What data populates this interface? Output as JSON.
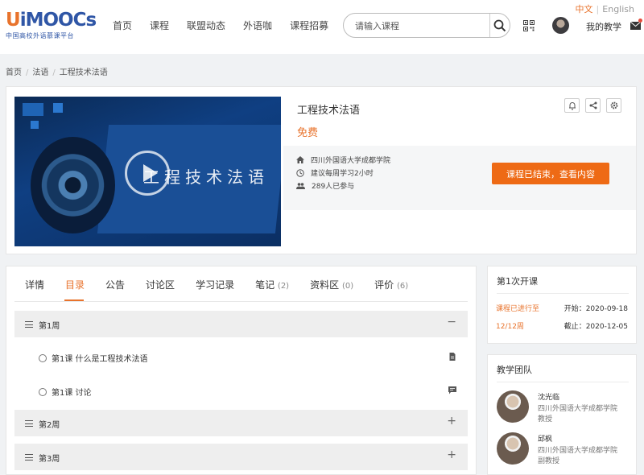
{
  "lang": {
    "zh": "中文",
    "sep": "|",
    "en": "English"
  },
  "logo": {
    "mark_u": "U",
    "mark_rest": "iMOOCs",
    "tagline": "中国高校外语慕课平台"
  },
  "nav": [
    "首页",
    "课程",
    "联盟动态",
    "外语咖",
    "课程招募"
  ],
  "search": {
    "placeholder": "请输入课程"
  },
  "user": {
    "my_teaching": "我的教学"
  },
  "breadcrumb": [
    "首页",
    "法语",
    "工程技术法语"
  ],
  "course": {
    "cover_title": "工程技术法语",
    "title": "工程技术法语",
    "price": "免费",
    "school": "四川外国语大学成都学院",
    "study_time": "建议每周学习2小时",
    "participants": "289人已参与",
    "status_button": "课程已结束，查看内容"
  },
  "tabs": [
    {
      "label": "详情",
      "count": ""
    },
    {
      "label": "目录",
      "count": ""
    },
    {
      "label": "公告",
      "count": ""
    },
    {
      "label": "讨论区",
      "count": ""
    },
    {
      "label": "学习记录",
      "count": ""
    },
    {
      "label": "笔记",
      "count": "(2)"
    },
    {
      "label": "资料区",
      "count": "(0)"
    },
    {
      "label": "评价",
      "count": "(6)"
    }
  ],
  "weeks": [
    {
      "label": "第1周",
      "toggle": "−"
    },
    {
      "label": "第2周",
      "toggle": "+"
    },
    {
      "label": "第3周",
      "toggle": "+"
    }
  ],
  "lessons": [
    {
      "label": "第1课 什么是工程技术法语",
      "icon": "document-icon"
    },
    {
      "label": "第1课 讨论",
      "icon": "chat-icon"
    }
  ],
  "session": {
    "title": "第1次开课",
    "progress_label": "课程已进行至",
    "progress_value": "12/12周",
    "start": "开始：2020-09-18",
    "end": "截止：2020-12-05"
  },
  "team": {
    "title": "教学团队",
    "members": [
      {
        "name": "沈光临",
        "school": "四川外国语大学成都学院",
        "title": "教授"
      },
      {
        "name": "邱枫",
        "school": "四川外国语大学成都学院",
        "title": "副教授"
      }
    ]
  },
  "colors": {
    "accent": "#e8732c",
    "button": "#ee6a15",
    "brand": "#2f56a6"
  }
}
